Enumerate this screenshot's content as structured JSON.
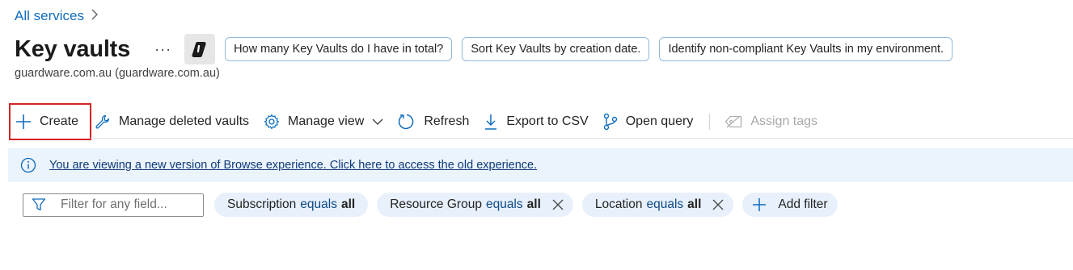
{
  "breadcrumb": {
    "root": "All services",
    "separator": ">"
  },
  "header": {
    "title": "Key vaults",
    "more": "···",
    "subtitle": "guardware.com.au (guardware.com.au)",
    "prompts": [
      "How many Key Vaults do I have in total?",
      "Sort Key Vaults by creation date.",
      "Identify non-compliant Key Vaults in my environment."
    ]
  },
  "toolbar": {
    "create": "Create",
    "manage_deleted": "Manage deleted vaults",
    "manage_view": "Manage view",
    "refresh": "Refresh",
    "export_csv": "Export to CSV",
    "open_query": "Open query",
    "assign_tags": "Assign tags"
  },
  "banner": {
    "text": "You are viewing a new version of Browse experience. Click here to access the old experience."
  },
  "filters": {
    "search_placeholder": "Filter for any field...",
    "pills": [
      {
        "field": "Subscription",
        "op": "equals",
        "value": "all"
      },
      {
        "field": "Resource Group",
        "op": "equals",
        "value": "all"
      },
      {
        "field": "Location",
        "op": "equals",
        "value": "all"
      }
    ],
    "add_filter": "Add filter"
  },
  "colors": {
    "accent": "#0f6cbd",
    "banner_bg": "#ebf3fc",
    "pill_bg": "#e7f0fb",
    "highlight": "#d62222"
  }
}
